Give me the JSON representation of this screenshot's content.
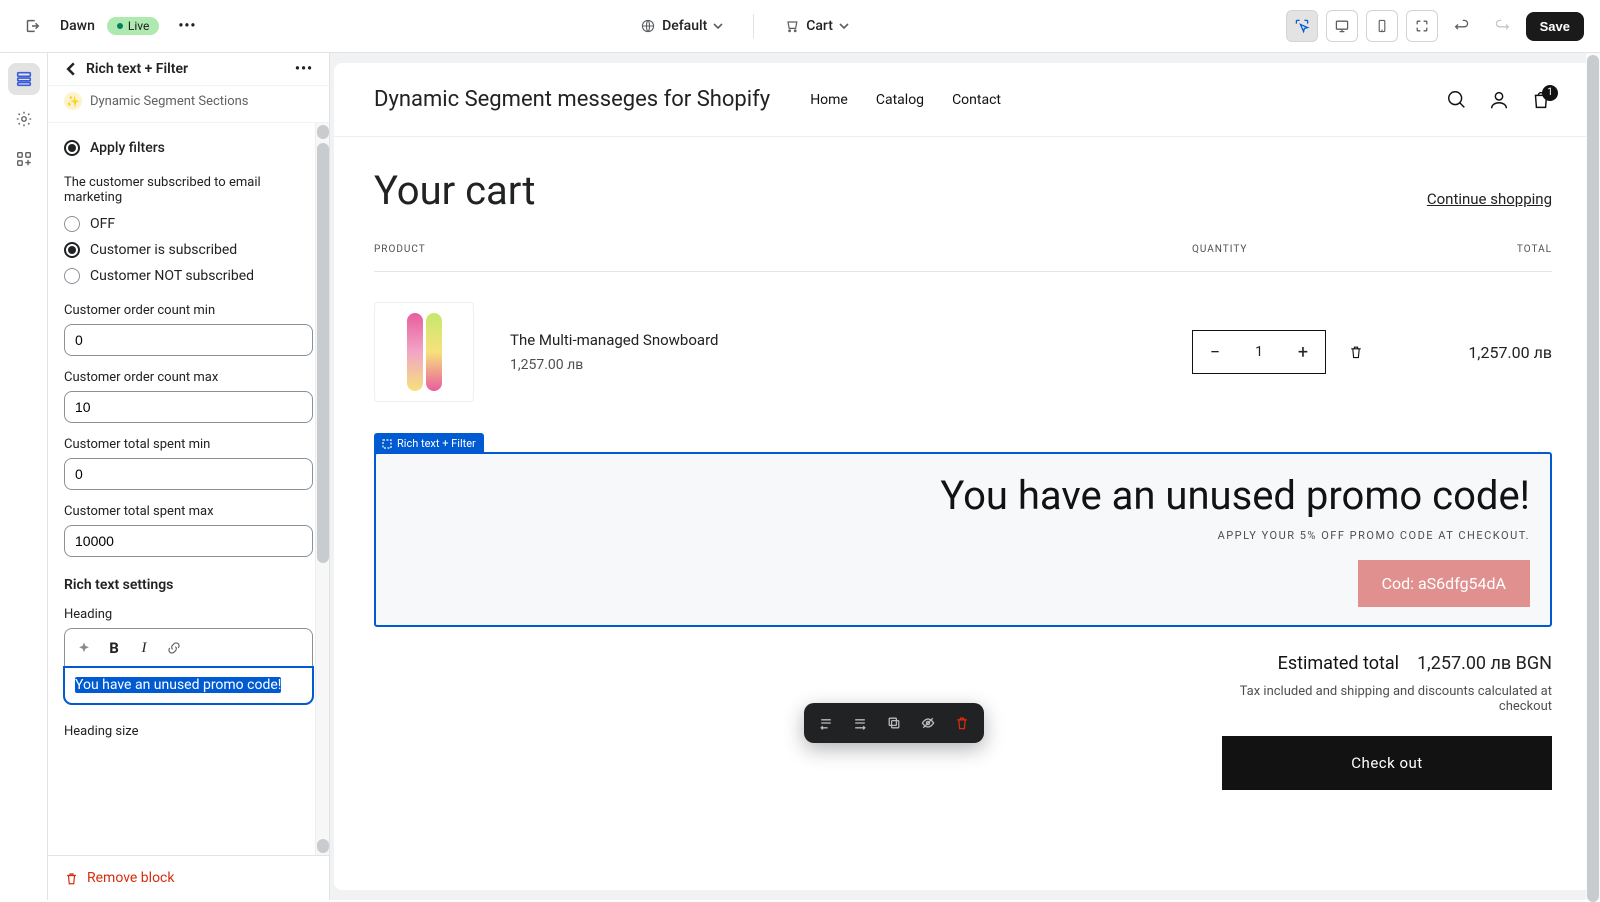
{
  "topbar": {
    "theme_name": "Dawn",
    "live_label": "Live",
    "context_label": "Default",
    "cart_label": "Cart",
    "save_label": "Save"
  },
  "sidebar": {
    "back_title": "Rich text + Filter",
    "sub_label": "Dynamic Segment Sections",
    "apply_filters_label": "Apply filters",
    "subscribe_group_label": "The customer subscribed to email marketing",
    "subscribe_options": {
      "off": "OFF",
      "subscribed": "Customer is subscribed",
      "not_subscribed": "Customer NOT subscribed"
    },
    "fields": {
      "order_min": {
        "label": "Customer order count min",
        "value": "0"
      },
      "order_max": {
        "label": "Customer order count max",
        "value": "10"
      },
      "spent_min": {
        "label": "Customer total spent min",
        "value": "0"
      },
      "spent_max": {
        "label": "Customer total spent max",
        "value": "10000"
      }
    },
    "rte_section_title": "Rich text settings",
    "heading_label": "Heading",
    "heading_value": "You have an unused promo code!",
    "heading_size_label": "Heading size",
    "remove_block_label": "Remove block"
  },
  "store": {
    "brand": "Dynamic Segment messeges for Shopify",
    "nav": {
      "home": "Home",
      "catalog": "Catalog",
      "contact": "Contact"
    },
    "cart_count": "1",
    "page_title": "Your cart",
    "continue_shopping": "Continue shopping",
    "cols": {
      "product": "PRODUCT",
      "quantity": "QUANTITY",
      "total": "TOTAL"
    },
    "item": {
      "name": "The Multi-managed Snowboard",
      "price": "1,257.00 лв",
      "qty": "1",
      "total": "1,257.00 лв"
    },
    "segment": {
      "tag": "Rich text + Filter",
      "heading": "You have an unused promo code!",
      "sub": "APPLY YOUR 5% OFF PROMO CODE AT CHECKOUT.",
      "code": "Cod: aS6dfg54dA"
    },
    "summary": {
      "est_label": "Estimated total",
      "est_value": "1,257.00 лв BGN",
      "tax_note": "Tax included and shipping and discounts calculated at checkout",
      "checkout": "Check out"
    }
  }
}
